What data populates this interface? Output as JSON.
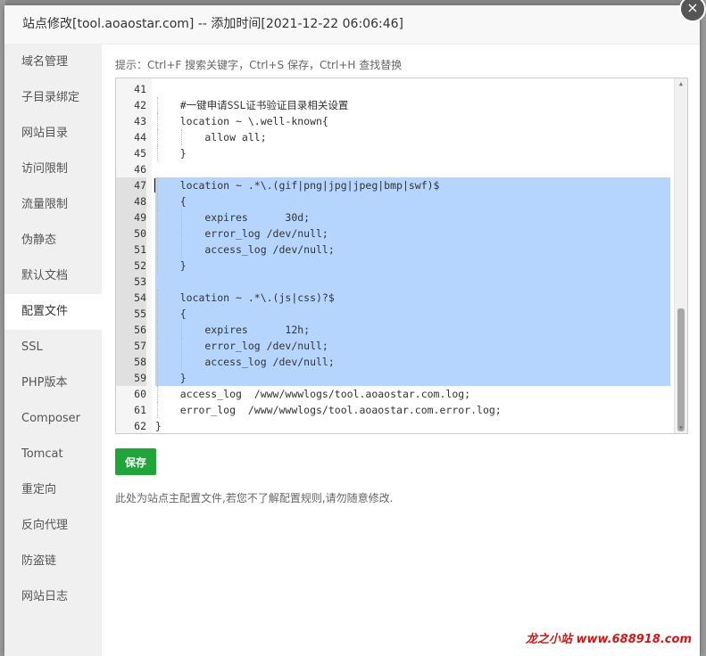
{
  "dialog": {
    "title": "站点修改[tool.aoaostar.com] -- 添加时间[2021-12-22 06:06:46]",
    "close_symbol": "×"
  },
  "sidebar": {
    "items": [
      {
        "label": "域名管理"
      },
      {
        "label": "子目录绑定"
      },
      {
        "label": "网站目录"
      },
      {
        "label": "访问限制"
      },
      {
        "label": "流量限制"
      },
      {
        "label": "伪静态"
      },
      {
        "label": "默认文档"
      },
      {
        "label": "配置文件",
        "active": true
      },
      {
        "label": "SSL"
      },
      {
        "label": "PHP版本"
      },
      {
        "label": "Composer"
      },
      {
        "label": "Tomcat"
      },
      {
        "label": "重定向"
      },
      {
        "label": "反向代理"
      },
      {
        "label": "防盗链"
      },
      {
        "label": "网站日志"
      }
    ]
  },
  "content": {
    "hint": "提示：Ctrl+F 搜索关键字，Ctrl+S 保存，Ctrl+H 查找替换",
    "save_label": "保存",
    "footnote": "此处为站点主配置文件,若您不了解配置规则,请勿随意修改."
  },
  "editor": {
    "lines": [
      {
        "n": "41",
        "text": ""
      },
      {
        "n": "42",
        "text": "    #一键申请SSL证书验证目录相关设置"
      },
      {
        "n": "43",
        "text": "    location ~ \\.well-known{"
      },
      {
        "n": "44",
        "text": "        allow all;"
      },
      {
        "n": "45",
        "text": "    }"
      },
      {
        "n": "46",
        "text": ""
      },
      {
        "n": "47",
        "text": "    location ~ .*\\.(gif|png|jpg|jpeg|bmp|swf)$",
        "sel": true
      },
      {
        "n": "48",
        "text": "    {",
        "sel": true
      },
      {
        "n": "49",
        "text": "        expires      30d;",
        "sel": true
      },
      {
        "n": "50",
        "text": "        error_log /dev/null;",
        "sel": true
      },
      {
        "n": "51",
        "text": "        access_log /dev/null;",
        "sel": true
      },
      {
        "n": "52",
        "text": "    }",
        "sel": true
      },
      {
        "n": "53",
        "text": "",
        "sel": true
      },
      {
        "n": "54",
        "text": "    location ~ .*\\.(js|css)?$",
        "sel": true
      },
      {
        "n": "55",
        "text": "    {",
        "sel": true
      },
      {
        "n": "56",
        "text": "        expires      12h;",
        "sel": true
      },
      {
        "n": "57",
        "text": "        error_log /dev/null;",
        "sel": true
      },
      {
        "n": "58",
        "text": "        access_log /dev/null;",
        "sel": true
      },
      {
        "n": "59",
        "text": "    }",
        "sel": true
      },
      {
        "n": "60",
        "text": "    access_log  /www/wwwlogs/tool.aoaostar.com.log;"
      },
      {
        "n": "61",
        "text": "    error_log  /www/wwwlogs/tool.aoaostar.com.error.log;"
      },
      {
        "n": "62",
        "text": "}"
      }
    ],
    "selection_color": "#b5d5ff"
  },
  "watermark": "龙之小站 www.688918.com",
  "colors": {
    "save_button": "#20a53a",
    "sidebar_bg": "#f0f0f0",
    "watermark": "#d01818"
  }
}
